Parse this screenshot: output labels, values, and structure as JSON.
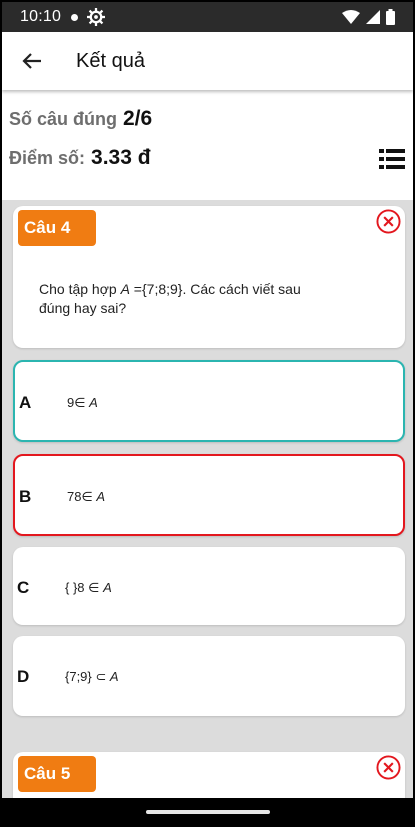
{
  "status_bar": {
    "time": "10:10"
  },
  "app_bar": {
    "title": "Kết quả"
  },
  "summary": {
    "correct_label": "Số câu đúng",
    "correct_value": "2/6",
    "score_label": "Điểm số:",
    "score_value": "3.33 đ"
  },
  "questions": [
    {
      "badge": "Câu 4",
      "text_before": "Cho tập hợp ",
      "set_var": "A",
      "text_after": " ={7;8;9}. Các cách viết sau đúng hay sai?",
      "answers": [
        {
          "letter": "A",
          "expr": "9∈ ",
          "var": "A",
          "state": "correct"
        },
        {
          "letter": "B",
          "expr": "78∈ ",
          "var": "A",
          "state": "incorrect"
        },
        {
          "letter": "C",
          "expr": "{ }8 ∈ ",
          "var": "A",
          "state": "normal"
        },
        {
          "letter": "D",
          "expr": "{7;9} ⊂ ",
          "var": "A",
          "state": "normal"
        }
      ]
    },
    {
      "badge": "Câu 5"
    }
  ],
  "colors": {
    "badge": "#f07c12",
    "correct_border": "#2bb5b0",
    "incorrect_border": "#e3171e"
  },
  "icons": [
    "back-arrow-icon",
    "list-icon",
    "close-circle-icon",
    "gear-icon",
    "wifi-icon",
    "signal-icon",
    "battery-icon"
  ]
}
